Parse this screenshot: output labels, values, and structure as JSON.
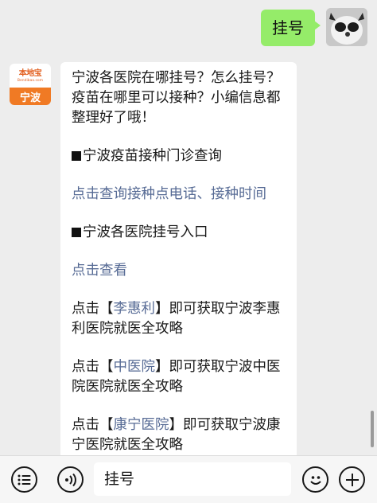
{
  "user_message": {
    "text": "挂号"
  },
  "bot": {
    "avatar_brand": "本地宝",
    "avatar_url": "Bendibao.com",
    "avatar_city": "宁波",
    "intro": "宁波各医院在哪挂号？怎么挂号？疫苗在哪里可以接种？小编信息都整理好了哦！",
    "section_vaccine_title": "宁波疫苗接种门诊查询",
    "section_vaccine_link": "点击查询接种点电话、接种时间",
    "section_hospital_title": "宁波各医院挂号入口",
    "section_hospital_link": "点击查看",
    "items": [
      {
        "prefix": "点击【",
        "link": "李惠利",
        "suffix": "】即可获取宁波李惠利医院就医全攻略"
      },
      {
        "prefix": "点击【",
        "link": "中医院",
        "suffix": "】即可获取宁波中医院医院就医全攻略"
      },
      {
        "prefix": "点击【",
        "link": "康宁医院",
        "suffix": "】即可获取宁波康宁医院就医全攻略"
      }
    ]
  },
  "input": {
    "value": "挂号"
  },
  "icons": {
    "list": "menu-list-icon",
    "voice": "voice-icon",
    "emoji": "emoji-icon",
    "plus": "plus-icon"
  }
}
